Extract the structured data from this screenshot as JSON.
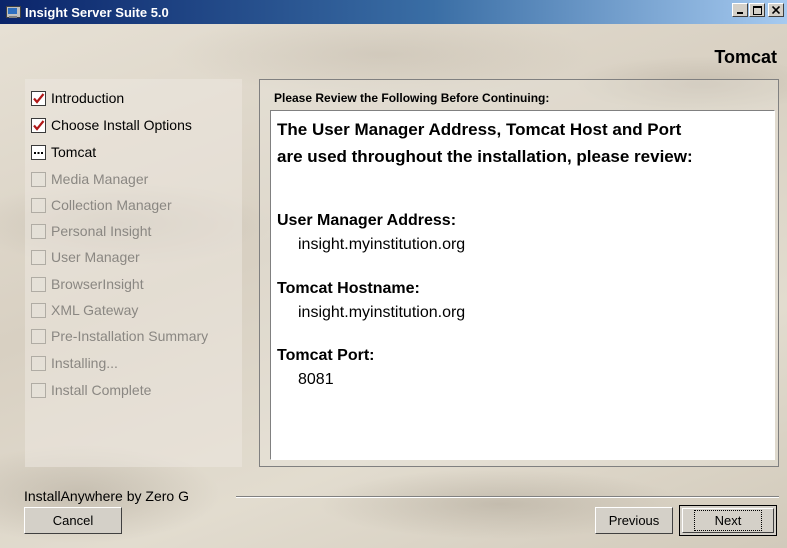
{
  "window": {
    "title": "Insight Server Suite 5.0"
  },
  "panel_heading": "Tomcat",
  "steps": [
    {
      "label": "Introduction",
      "state": "done"
    },
    {
      "label": "Choose Install Options",
      "state": "done"
    },
    {
      "label": "Tomcat",
      "state": "current"
    },
    {
      "label": "Media Manager",
      "state": "pending"
    },
    {
      "label": "Collection Manager",
      "state": "pending"
    },
    {
      "label": "Personal Insight",
      "state": "pending"
    },
    {
      "label": "User Manager",
      "state": "pending"
    },
    {
      "label": "BrowserInsight",
      "state": "pending"
    },
    {
      "label": "XML Gateway",
      "state": "pending"
    },
    {
      "label": "Pre-Installation Summary",
      "state": "pending"
    },
    {
      "label": "Installing...",
      "state": "pending"
    },
    {
      "label": "Install Complete",
      "state": "pending"
    }
  ],
  "review": {
    "label": "Please Review the Following Before Continuing:",
    "intro_line1": "The User Manager Address, Tomcat Host and Port",
    "intro_line2": "are used throughout the installation, please review:",
    "fields": [
      {
        "label": "User Manager Address:",
        "value": "insight.myinstitution.org"
      },
      {
        "label": "Tomcat Hostname:",
        "value": "insight.myinstitution.org"
      },
      {
        "label": "Tomcat Port:",
        "value": "8081"
      }
    ]
  },
  "footer": {
    "brand": "InstallAnywhere by Zero G",
    "cancel_label": "Cancel",
    "previous_label": "Previous",
    "next_label": "Next"
  },
  "icons": {
    "app": "installer-window-icon",
    "minimize": "minimize-icon",
    "maximize": "maximize-icon",
    "close": "close-icon",
    "done": "checkmark-icon",
    "current": "ellipsis-icon"
  },
  "colors": {
    "titlebar_start": "#0a246a",
    "titlebar_end": "#a6caf0",
    "check": "#b01818"
  }
}
